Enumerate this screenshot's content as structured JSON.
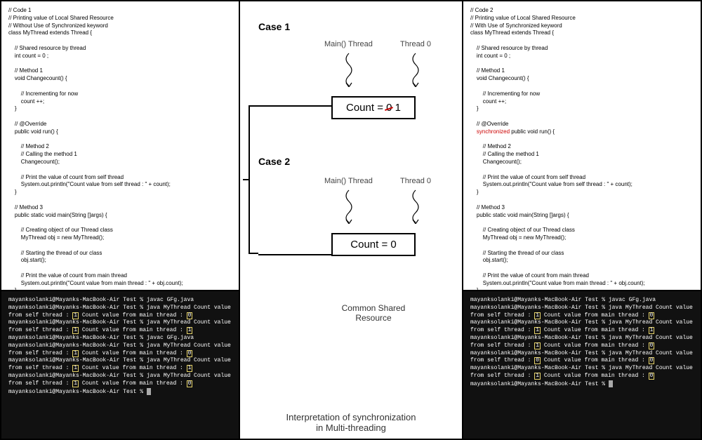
{
  "code_left": {
    "title_comment": "// Code 1",
    "lines": [
      "// Code 1",
      "// Printing value of Local Shared Resource",
      "// Without Use of Synchronized keyword",
      "class MyThread extends Thread {",
      "",
      "    // Shared resource by thread",
      "    int count = 0 ;",
      "",
      "    // Method 1",
      "    void Changecount() {",
      "",
      "        // Incrementing for now",
      "        count ++;",
      "    }",
      "",
      "    // @Override",
      "    public void run() {",
      "",
      "        // Method 2",
      "        // Calling the method 1",
      "        Changecount();",
      "",
      "        // Print the value of count from self thread",
      "        System.out.println(\"Count value from self thread : \" + count);",
      "    }",
      "",
      "    // Method 3",
      "    public static void main(String []args) {",
      "",
      "        // Creating object of our Thread class",
      "        MyThread obj = new MyThread();",
      "",
      "        // Starting the thread of our class",
      "        obj.start();",
      "",
      "        // Print the value of count from main thread",
      "        System.out.println(\"Count value from main thread : \" + obj.count);",
      "    }",
      "}"
    ]
  },
  "code_right": {
    "lines": [
      "// Code 2",
      "// Printing value of Local Shared Resource",
      "// With Use of Synchronized keyword",
      "class MyThread extends Thread {",
      "",
      "    // Shared resource by thread",
      "    int count = 0 ;",
      "",
      "    // Method 1",
      "    void Changecount() {",
      "",
      "        // Incrementing for now",
      "        count ++;",
      "    }",
      "",
      "    // @Override",
      "    "
    ],
    "sync_keyword": "synchronized",
    "sync_rest": " public void run() {",
    "lines2": [
      "",
      "        // Method 2",
      "        // Calling the method 1",
      "        Changecount();",
      "",
      "        // Print the value of count from self thread",
      "        System.out.println(\"Count value from self thread : \" + count);",
      "    }",
      "",
      "    // Method 3",
      "    public static void main(String []args) {",
      "",
      "        // Creating object of our Thread class",
      "        MyThread obj = new MyThread();",
      "",
      "        // Starting the thread of our class",
      "        obj.start();",
      "",
      "        // Print the value of count from main thread",
      "        System.out.println(\"Count value from main thread : \" + obj.count);",
      "    }",
      "}"
    ]
  },
  "terminal_left": {
    "prompt": "mayanksolanki@Mayanks-MacBook-Air Test % ",
    "cmd_compile": "javac GFg.java",
    "cmd_run": "java MyThread",
    "line_self": "Count value from self thread : ",
    "line_main": "Count value from main thread : ",
    "runs": [
      {
        "self": "1",
        "main": "0"
      },
      {
        "self": "1",
        "main": "1"
      },
      {
        "self": "1",
        "main": "0"
      },
      {
        "self": "1",
        "main": "1"
      },
      {
        "self": "1",
        "main": "0"
      }
    ]
  },
  "terminal_right": {
    "runs": [
      {
        "self": "1",
        "main": "0"
      },
      {
        "self": "1",
        "main": "1"
      },
      {
        "self": "1",
        "main": "0"
      },
      {
        "self": "0",
        "main": "0"
      },
      {
        "self": "1",
        "main": "0"
      }
    ]
  },
  "diagram": {
    "case1": "Case 1",
    "case2": "Case 2",
    "main_thread": "Main() Thread",
    "thread0": "Thread 0",
    "count1_prefix": "Count = ",
    "count1_old": "0",
    "count1_new": "  1",
    "count2": "Count = 0",
    "csr": "Common Shared\nResource",
    "footer": "Interpretation of synchronization\nin Multi-threading"
  }
}
